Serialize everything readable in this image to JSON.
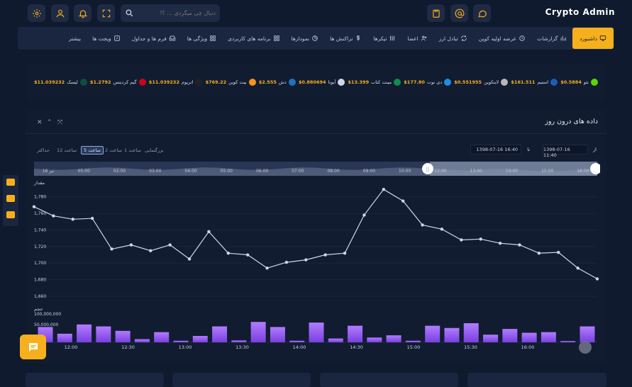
{
  "brand": "Crypto Admin",
  "search": {
    "placeholder": "دنبال چی میگردی ... ؟!"
  },
  "nav": {
    "items": [
      {
        "label": "داشبورد",
        "icon": "monitor-icon",
        "active": true
      },
      {
        "label": "گزارشات",
        "icon": "chart-bar-icon"
      },
      {
        "label": "عرضه اولیه کوین",
        "icon": "clock-icon"
      },
      {
        "label": "تبادل ارز",
        "icon": "exchange-icon"
      },
      {
        "label": "اعضا",
        "icon": "users-icon"
      },
      {
        "label": "تیکرها",
        "icon": "sliders-icon"
      },
      {
        "label": "تراکنش ها",
        "icon": "dollar-icon"
      },
      {
        "label": "نمودارها",
        "icon": "pie-icon"
      },
      {
        "label": "برنامه های کاربردی",
        "icon": "grid-icon"
      },
      {
        "label": "ویژگی ها",
        "icon": "grid-icon"
      },
      {
        "label": "فرم ها و جداول",
        "icon": "inbox-icon"
      },
      {
        "label": "ویجت ها",
        "icon": "edit-icon"
      },
      {
        "label": "بیشتر",
        "icon": "more-icon"
      }
    ]
  },
  "ticker": [
    {
      "name": "نئو",
      "price": "$0.5884",
      "color": "#5fd400"
    },
    {
      "name": "استیم",
      "price": "$161.511",
      "color": "#1a5fb4"
    },
    {
      "name": "لایتکوین",
      "price": "$0.551955",
      "color": "#b8b8b8"
    },
    {
      "name": "دی نوت",
      "price": "$177.80",
      "color": "#1f8ce6"
    },
    {
      "name": "مینت کتاب",
      "price": "$13.399",
      "color": "#0b8f4a"
    },
    {
      "name": "آیوتا",
      "price": "$0.880694",
      "color": "#cfd6e4"
    },
    {
      "name": "دش",
      "price": "$2.555",
      "color": "#1c75bc"
    },
    {
      "name": "بیت کوین",
      "price": "$769.22",
      "color": "#f7931a"
    },
    {
      "name": "اتریوم",
      "price": "$11.039232",
      "color": "#222222"
    },
    {
      "name": "گیم کردیتس",
      "price": "$1.2792",
      "color": "#d0021b"
    },
    {
      "name": "لیسک",
      "price": "$11.039232",
      "color": "#0d4e3e"
    }
  ],
  "panel": {
    "title": "داده های درون روز",
    "zoom_label": "بزرگنمایی",
    "zoom": [
      "1 ساعت",
      "2 ساعت",
      "5 ساعت",
      "12 ساعت",
      "حداکثر"
    ],
    "zoom_selected": "5 ساعت",
    "range_from_label": "از",
    "range_from": "1398-07-16 11:40",
    "range_to_label": "تا",
    "range_to": "1398-07-16 16:40",
    "price_label": "مقدار",
    "volume_label": "حجم"
  },
  "chart_data": {
    "type": "line",
    "y_ticks": [
      "1,780",
      "1,760",
      "1,740",
      "1,720",
      "1,700",
      "1,680",
      "1,660"
    ],
    "ylim": [
      1660,
      1790
    ],
    "prices": [
      1768,
      1757,
      1753,
      1754,
      1717,
      1722,
      1715,
      1722,
      1705,
      1738,
      1712,
      1710,
      1694,
      1701,
      1704,
      1710,
      1712,
      1758,
      1789,
      1775,
      1746,
      1741,
      1728,
      1729,
      1724,
      1722,
      1712,
      1713,
      1694,
      1681
    ],
    "volumes": [
      48,
      27,
      56,
      50,
      36,
      10,
      32,
      5,
      20,
      50,
      6,
      64,
      48,
      5,
      62,
      12,
      52,
      15,
      22,
      5,
      52,
      45,
      60,
      24,
      42,
      30,
      32,
      4,
      50
    ],
    "volume_ticks": [
      "100,000,000",
      "50,000,000"
    ],
    "x_ticks": [
      "12:00",
      "12:30",
      "13:00",
      "13:30",
      "14:00",
      "14:30",
      "15:00",
      "15:30",
      "16:00"
    ],
    "navigator_ticks": [
      "تیر 16",
      "05:00",
      "02:00",
      "03:00",
      "04:00",
      "05:00",
      "06:00",
      "07:00",
      "08:00",
      "09:00",
      "10:00",
      "12:00",
      "13:00",
      "14:00",
      "15:00",
      "16:00"
    ]
  },
  "colors": {
    "accent": "#f6b01d",
    "bg": "#0f1a2e",
    "panel": "#111c31",
    "line": "#cfd6e4",
    "volume": "#9b6cff"
  }
}
